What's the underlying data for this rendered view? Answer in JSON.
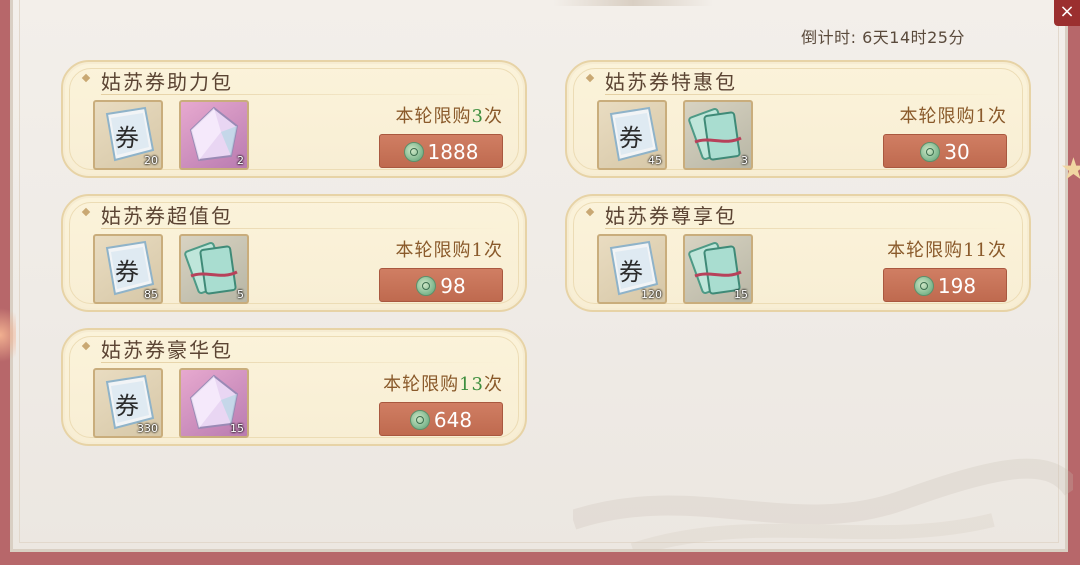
{
  "countdown": {
    "label": "倒计时:",
    "value": " 6天14时25分"
  },
  "packages": [
    {
      "title": "姑苏券助力包",
      "limit_prefix": "本轮限购",
      "limit_num": "3",
      "limit_suffix": "次",
      "price": "1888",
      "items": [
        {
          "icon": "ticket-icon",
          "count": "20"
        },
        {
          "icon": "crystal-icon",
          "count": "2"
        }
      ]
    },
    {
      "title": "姑苏券特惠包",
      "limit_prefix": "本轮限购",
      "limit_num": "1",
      "limit_suffix": "次",
      "price": "30",
      "items": [
        {
          "icon": "ticket-icon",
          "count": "45"
        },
        {
          "icon": "banknote-icon",
          "count": "3"
        }
      ]
    },
    {
      "title": "姑苏券超值包",
      "limit_prefix": "本轮限购",
      "limit_num": "1",
      "limit_suffix": "次",
      "price": "98",
      "items": [
        {
          "icon": "ticket-icon",
          "count": "85"
        },
        {
          "icon": "banknote-icon",
          "count": "5"
        }
      ]
    },
    {
      "title": "姑苏券尊享包",
      "limit_prefix": "本轮限购",
      "limit_num": "11",
      "limit_suffix": "次",
      "price": "198",
      "items": [
        {
          "icon": "ticket-icon",
          "count": "120"
        },
        {
          "icon": "banknote-icon",
          "count": "15"
        }
      ]
    },
    {
      "title": "姑苏券豪华包",
      "limit_prefix": "本轮限购",
      "limit_num": "13",
      "limit_suffix": "次",
      "price": "648",
      "items": [
        {
          "icon": "ticket-icon",
          "count": "330"
        },
        {
          "icon": "crystal-icon",
          "count": "15"
        }
      ]
    }
  ],
  "ticket_glyph": "券",
  "colors": {
    "accent_button": "#c46f53",
    "limit_number": "#3e8e3e",
    "card_bg": "#fbf3da"
  }
}
